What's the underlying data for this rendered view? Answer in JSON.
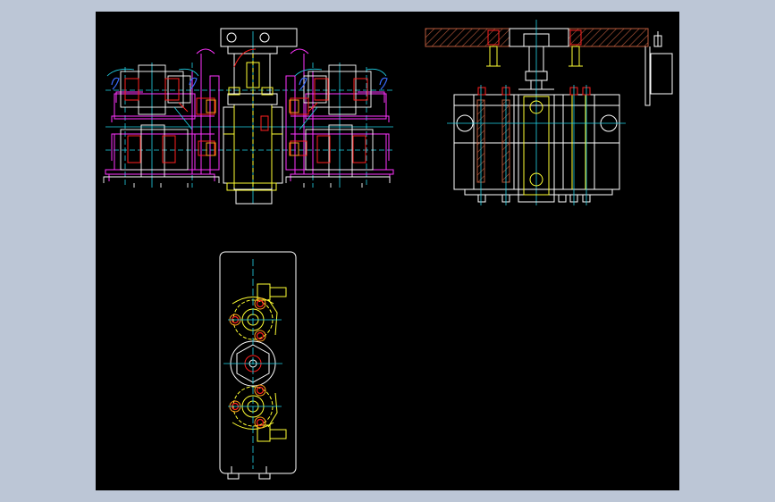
{
  "viewer": {
    "background": "#bcc6d6",
    "canvas_background": "#000000"
  },
  "drawing": {
    "views": [
      "front-section-view",
      "side-view",
      "top-view"
    ],
    "palette": {
      "outline": "#ffffff",
      "magenta": "#ff33ff",
      "red": "#ff2020",
      "yellow": "#ffff33",
      "cyan": "#22d3e8",
      "hatch": "#b85a3c",
      "blue": "#3a6cff",
      "orange": "#ff9c1a"
    }
  }
}
